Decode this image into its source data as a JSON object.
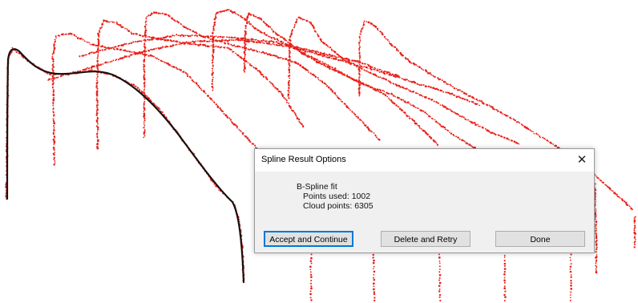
{
  "dialog": {
    "title": "Spline Result Options",
    "close_glyph": "✕",
    "message": {
      "heading": "B-Spline fit",
      "points_used": "Points used: 1002",
      "cloud_points": "Cloud points: 6305"
    },
    "buttons": {
      "accept": "Accept and Continue",
      "delete": "Delete and Retry",
      "done": "Done"
    }
  },
  "colors": {
    "point_cloud": "#e8201a",
    "fitted_spline": "#1a1010"
  }
}
